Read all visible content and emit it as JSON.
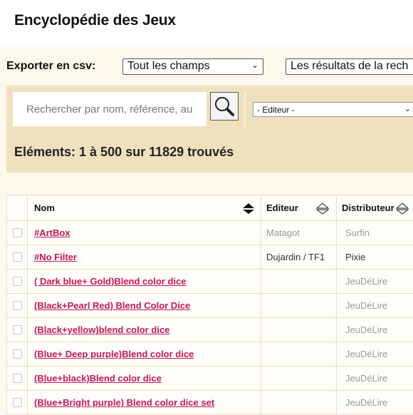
{
  "header": {
    "title": "Encyclopédie des Jeux"
  },
  "export": {
    "label": "Exporter en csv:",
    "fields_select": "Tout les champs",
    "results_select": "Les résultats de la rech"
  },
  "search": {
    "placeholder": "Rechercher par nom, référence, au",
    "editor_select": "- Editeur -",
    "result_count": "Eléments: 1 à 500 sur 11829 trouvés"
  },
  "table": {
    "columns": {
      "name": "Nom",
      "editor": "Editeur",
      "distributor": "Distributeur"
    },
    "rows": [
      {
        "name": "#ArtBox",
        "editor": "Matagot",
        "distributor": "Surfin",
        "grey_editor": true,
        "grey_distributor": true
      },
      {
        "name": "#No Filter",
        "editor": "Dujardin / TF1",
        "distributor": "Pixie",
        "grey_editor": false,
        "grey_distributor": false
      },
      {
        "name": "( Dark blue+ Gold)Blend color dice",
        "editor": "",
        "distributor": "JeuDéLire",
        "grey_editor": true,
        "grey_distributor": true
      },
      {
        "name": "(Black+Pearl Red) Blend Color Dice",
        "editor": "",
        "distributor": "JeuDéLire",
        "grey_editor": true,
        "grey_distributor": true
      },
      {
        "name": "(Black+yellow)blend color dice",
        "editor": "",
        "distributor": "JeuDéLire",
        "grey_editor": true,
        "grey_distributor": true
      },
      {
        "name": "(Blue+ Deep purple)Blend color dice",
        "editor": "",
        "distributor": "JeuDéLire",
        "grey_editor": true,
        "grey_distributor": true
      },
      {
        "name": "(Blue+black)Blend color dice",
        "editor": "",
        "distributor": "JeuDéLire",
        "grey_editor": true,
        "grey_distributor": true
      },
      {
        "name": "(Blue+Bright purple) Blend color dice set",
        "editor": "",
        "distributor": "JeuDéLire",
        "grey_editor": true,
        "grey_distributor": true
      }
    ]
  },
  "icons": {
    "search": "magnifier-icon",
    "sort": "sort-diamond-icon",
    "dropdown": "chevron-down-icon"
  },
  "colors": {
    "link": "#c2185b",
    "panel": "#efe1bd",
    "background": "#fdf8ec"
  }
}
